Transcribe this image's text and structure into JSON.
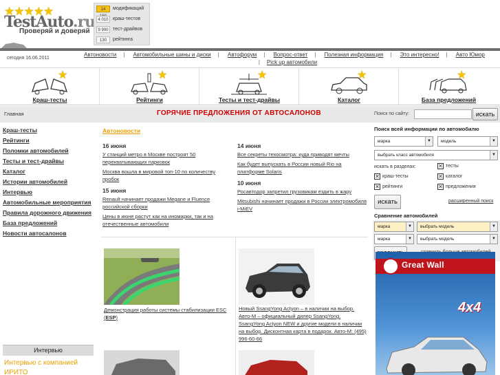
{
  "logo": {
    "brand": "TestAuto",
    "tld": ".ru",
    "tagline": "Проверяй и доверяй"
  },
  "stats": [
    {
      "value": "14 150",
      "label": "модификаций",
      "highlight": true
    },
    {
      "value": "4 010",
      "label": "краш-тестов",
      "highlight": false
    },
    {
      "value": "9 900",
      "label": "тест-драйвов",
      "highlight": false
    },
    {
      "value": "130",
      "label": "рейтинга",
      "highlight": false
    }
  ],
  "header": {
    "date": "сегодня 16.06.2011",
    "nav": [
      "Автоновости",
      "Автомобильные шины и диски",
      "Автофорум",
      "Вопрос-ответ",
      "Полезная информация",
      "Это интересно!",
      "Авто Юмор",
      "Pick up автомобили"
    ]
  },
  "categories": [
    {
      "label": "Краш-тесты",
      "icon": "crash-test-icon"
    },
    {
      "label": "Рейтинги",
      "icon": "rating-icon"
    },
    {
      "label": "Тесты и тест-драйвы",
      "icon": "test-drive-icon"
    },
    {
      "label": "Каталог",
      "icon": "catalog-icon"
    },
    {
      "label": "База предложений",
      "icon": "offers-icon"
    }
  ],
  "bar": {
    "breadcrumb": "Главная",
    "hot_offers": "ГОРЯЧИЕ ПРЕДЛОЖЕНИЯ ОТ АВТОСАЛОНОВ",
    "site_search_label": "Поиск по сайту:",
    "site_search_button": "искать"
  },
  "sidebar": {
    "items": [
      "Краш-тесты",
      "Рейтинги",
      "Поломки автомобилей",
      "Тесты и тест-драйвы",
      "Каталог",
      "Истории автомобилей",
      "Интервью",
      "Автомобильные мероприятия",
      "Правила дорожного движения",
      "База предложений",
      "Новости автосалонов"
    ],
    "interview_head": "Интервью",
    "interview_link": "Интервью с компанией ИРИТО"
  },
  "news": {
    "section": "Автоновости",
    "left": [
      {
        "date": "16 июня",
        "items": [
          "У станций метро в Москве построят 50 перехватывающих парковок",
          "Москва вошла в мировой топ-10 по количеству пробок"
        ]
      },
      {
        "date": "15 июня",
        "items": [
          "Renault начинает продажи Megane и Fluence российской сборки",
          "Цены в июне растут как на иномарки, так и на отечественные автомобили"
        ]
      }
    ],
    "right": [
      {
        "date": "14 июня",
        "items": [
          "Все секреты техосмотра: куда приводят мечты",
          "Как будет выпускать в России новый Rio на платформе Solaris"
        ]
      },
      {
        "date": "10 июня",
        "items": [
          "Росавтодор запретил грузовикам ездить в жару",
          "Mitsubishi начинает продажи в России электромобиля i-MiEV"
        ]
      }
    ]
  },
  "gallery": [
    {
      "caption_pre": "Демонстрация работы системы стабилизации ESC (",
      "caption_bold": "ESP",
      "caption_post": ")"
    },
    {
      "caption": "Новый SsangYong Actyon – в наличии на выбор. Авто-М – официальный дилер SsangYong. SsangYong Actyon NEW и другие модели в наличии на выбор. Дисконтная карта в подарок. Авто-М: (495) 996-60-66"
    }
  ],
  "search_panel": {
    "title": "Поиск всей информации по автомобилю",
    "make": "марка",
    "model": "модель",
    "class": "выбрать класс автомобиля",
    "sections_label": "искать в разделах:",
    "checkboxes": [
      "тесты",
      "краш-тесты",
      "каталог",
      "рейтинги",
      "предложения"
    ],
    "search_button": "искать",
    "advanced": "расширенный поиск"
  },
  "compare_panel": {
    "title": "Сравнение автомобилей",
    "make": "марка",
    "model": "выбрать модель",
    "button": "сравнить",
    "more": "сравнить больше автомобилей"
  },
  "banner": {
    "brand": "Great Wall",
    "badge": "4x4"
  },
  "colors": {
    "accent": "#e5a100",
    "hot": "#d00000",
    "star": "#f5c400",
    "bar": "#e9e9e9"
  }
}
